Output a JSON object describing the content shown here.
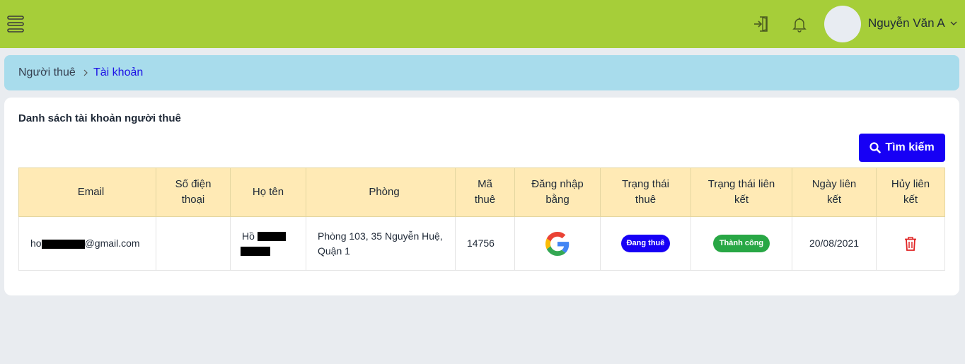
{
  "header": {
    "username": "Nguyễn Văn A",
    "icons": [
      "menu-icon",
      "login-icon",
      "bell-icon",
      "chevron-down-icon"
    ],
    "bg_color": "#a6ce39"
  },
  "breadcrumb": {
    "root": "Người thuê",
    "current": "Tài khoản"
  },
  "card": {
    "title": "Danh sách tài khoản người thuê",
    "search_label": "Tìm kiếm"
  },
  "table": {
    "headers": [
      "Email",
      "Số điện thoại",
      "Họ tên",
      "Phòng",
      "Mã thuê",
      "Đăng nhập bằng",
      "Trạng thái thuê",
      "Trạng thái liên kết",
      "Ngày liên kết",
      "Hủy liên kết"
    ],
    "rows": [
      {
        "email_prefix": "ho",
        "email_suffix": "@gmail.com",
        "phone": "",
        "name_prefix": "Hồ",
        "room": "Phòng 103, 35 Nguyễn Huệ, Quận 1",
        "code": "14756",
        "login_method": "google-icon",
        "rent_status": "Đang thuê",
        "link_status": "Thành công",
        "link_date": "20/08/2021"
      }
    ]
  },
  "colors": {
    "accent": "#1700f5",
    "success": "#28a745",
    "danger": "#e02424",
    "breadcrumb_bg": "#a8dcec",
    "table_header_bg": "#ffeab5"
  }
}
